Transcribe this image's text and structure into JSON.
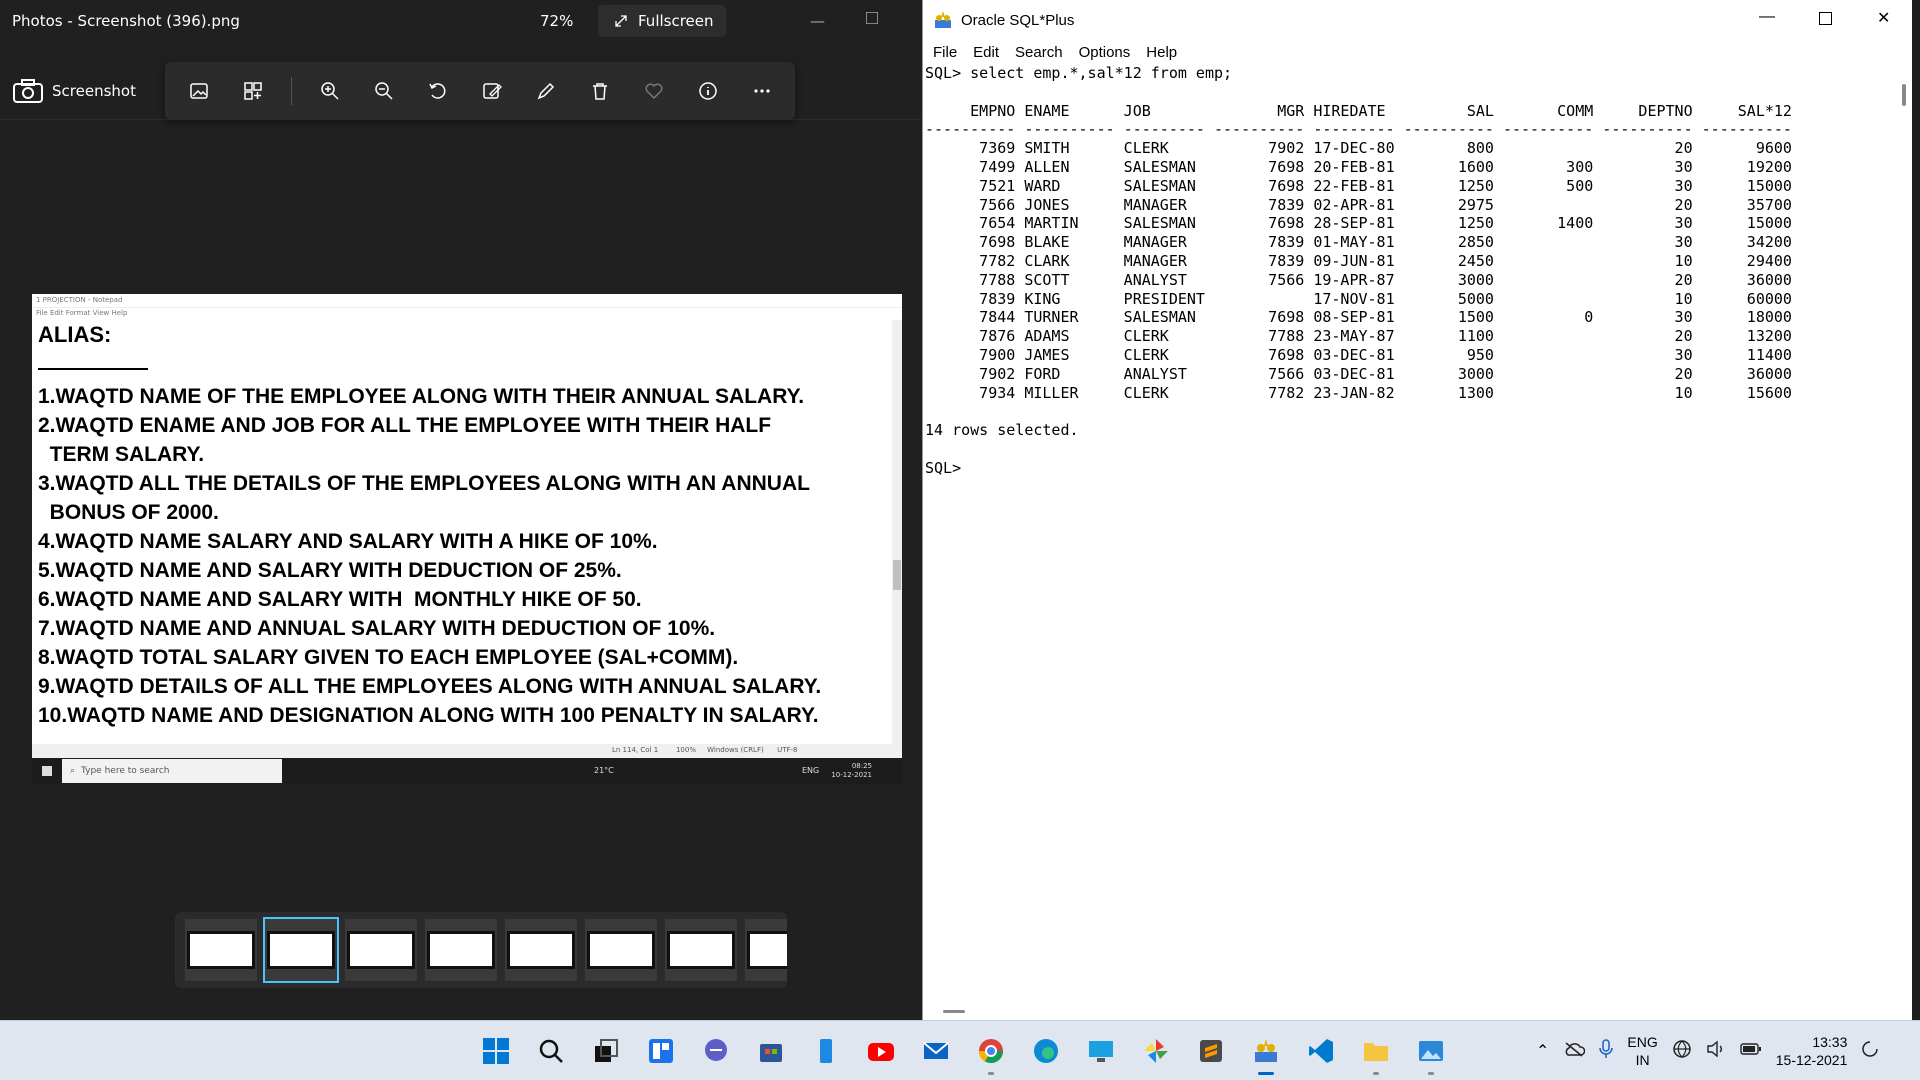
{
  "photos": {
    "title": "Photos - Screenshot (396).png",
    "zoom": "72%",
    "fullscreen_label": "Fullscreen",
    "screenshot_label": "Screenshot",
    "tools": [
      "photo-icon",
      "collage-icon",
      "zoom-in-icon",
      "zoom-out-icon",
      "rotate-icon",
      "edit-icon",
      "draw-icon",
      "delete-icon",
      "heart-icon",
      "info-icon",
      "more-icon"
    ]
  },
  "notepad": {
    "title": "1 PROJECTION - Notepad",
    "menu": "File  Edit  Format  View  Help",
    "heading": "ALIAS:",
    "lines": [
      "1.WAQTD NAME OF THE EMPLOYEE ALONG WITH THEIR ANNUAL SALARY.",
      "2.WAQTD ENAME AND JOB FOR ALL THE EMPLOYEE WITH THEIR HALF",
      "  TERM SALARY.",
      "3.WAQTD ALL THE DETAILS OF THE EMPLOYEES ALONG WITH AN ANNUAL",
      "  BONUS OF 2000.",
      "4.WAQTD NAME SALARY AND SALARY WITH A HIKE OF 10%.",
      "5.WAQTD NAME AND SALARY WITH DEDUCTION OF 25%.",
      "6.WAQTD NAME AND SALARY WITH  MONTHLY HIKE OF 50.",
      "7.WAQTD NAME AND ANNUAL SALARY WITH DEDUCTION OF 10%.",
      "8.WAQTD TOTAL SALARY GIVEN TO EACH EMPLOYEE (SAL+COMM).",
      "9.WAQTD DETAILS OF ALL THE EMPLOYEES ALONG WITH ANNUAL SALARY.",
      "10.WAQTD NAME AND DESIGNATION ALONG WITH 100 PENALTY IN SALARY."
    ],
    "status": "Ln 114, Col 1        100%     Windows (CRLF)      UTF-8",
    "search_placeholder": "Type here to search",
    "weather": "21°C",
    "lang": "ENG",
    "time": "08:25",
    "date": "10-12-2021"
  },
  "sqlplus": {
    "title": "Oracle SQL*Plus",
    "menu": [
      "File",
      "Edit",
      "Search",
      "Options",
      "Help"
    ],
    "console_lines": [
      "SQL> select emp.*,sal*12 from emp;",
      "",
      "     EMPNO ENAME      JOB              MGR HIREDATE         SAL       COMM     DEPTNO     SAL*12",
      "---------- ---------- --------- ---------- --------- ---------- ---------- ---------- ----------",
      "      7369 SMITH      CLERK           7902 17-DEC-80        800                    20       9600",
      "      7499 ALLEN      SALESMAN        7698 20-FEB-81       1600        300         30      19200",
      "      7521 WARD       SALESMAN        7698 22-FEB-81       1250        500         30      15000",
      "      7566 JONES      MANAGER         7839 02-APR-81       2975                    20      35700",
      "      7654 MARTIN     SALESMAN        7698 28-SEP-81       1250       1400         30      15000",
      "      7698 BLAKE      MANAGER         7839 01-MAY-81       2850                    30      34200",
      "      7782 CLARK      MANAGER         7839 09-JUN-81       2450                    10      29400",
      "      7788 SCOTT      ANALYST         7566 19-APR-87       3000                    20      36000",
      "      7839 KING       PRESIDENT            17-NOV-81       5000                    10      60000",
      "      7844 TURNER     SALESMAN        7698 08-SEP-81       1500          0         30      18000",
      "      7876 ADAMS      CLERK           7788 23-MAY-87       1100                    20      13200",
      "      7900 JAMES      CLERK           7698 03-DEC-81        950                    30      11400",
      "      7902 FORD       ANALYST         7566 03-DEC-81       3000                    20      36000",
      "      7934 MILLER     CLERK           7782 23-JAN-82       1300                    10      15600",
      "",
      "14 rows selected.",
      "",
      "SQL>"
    ]
  },
  "taskbar": {
    "apps": [
      "windows-start-icon",
      "search-icon",
      "task-view-icon",
      "widgets-icon",
      "chat-icon",
      "store-icon",
      "phone-icon",
      "youtube-icon",
      "mail-icon",
      "chrome-icon",
      "edge-icon",
      "desktop-icon",
      "pinwheel-icon",
      "sublime-icon",
      "sqlplus-icon",
      "vscode-icon",
      "file-explorer-icon",
      "photos-icon"
    ],
    "lang_top": "ENG",
    "lang_bottom": "IN",
    "time": "13:33",
    "date": "15-12-2021"
  }
}
